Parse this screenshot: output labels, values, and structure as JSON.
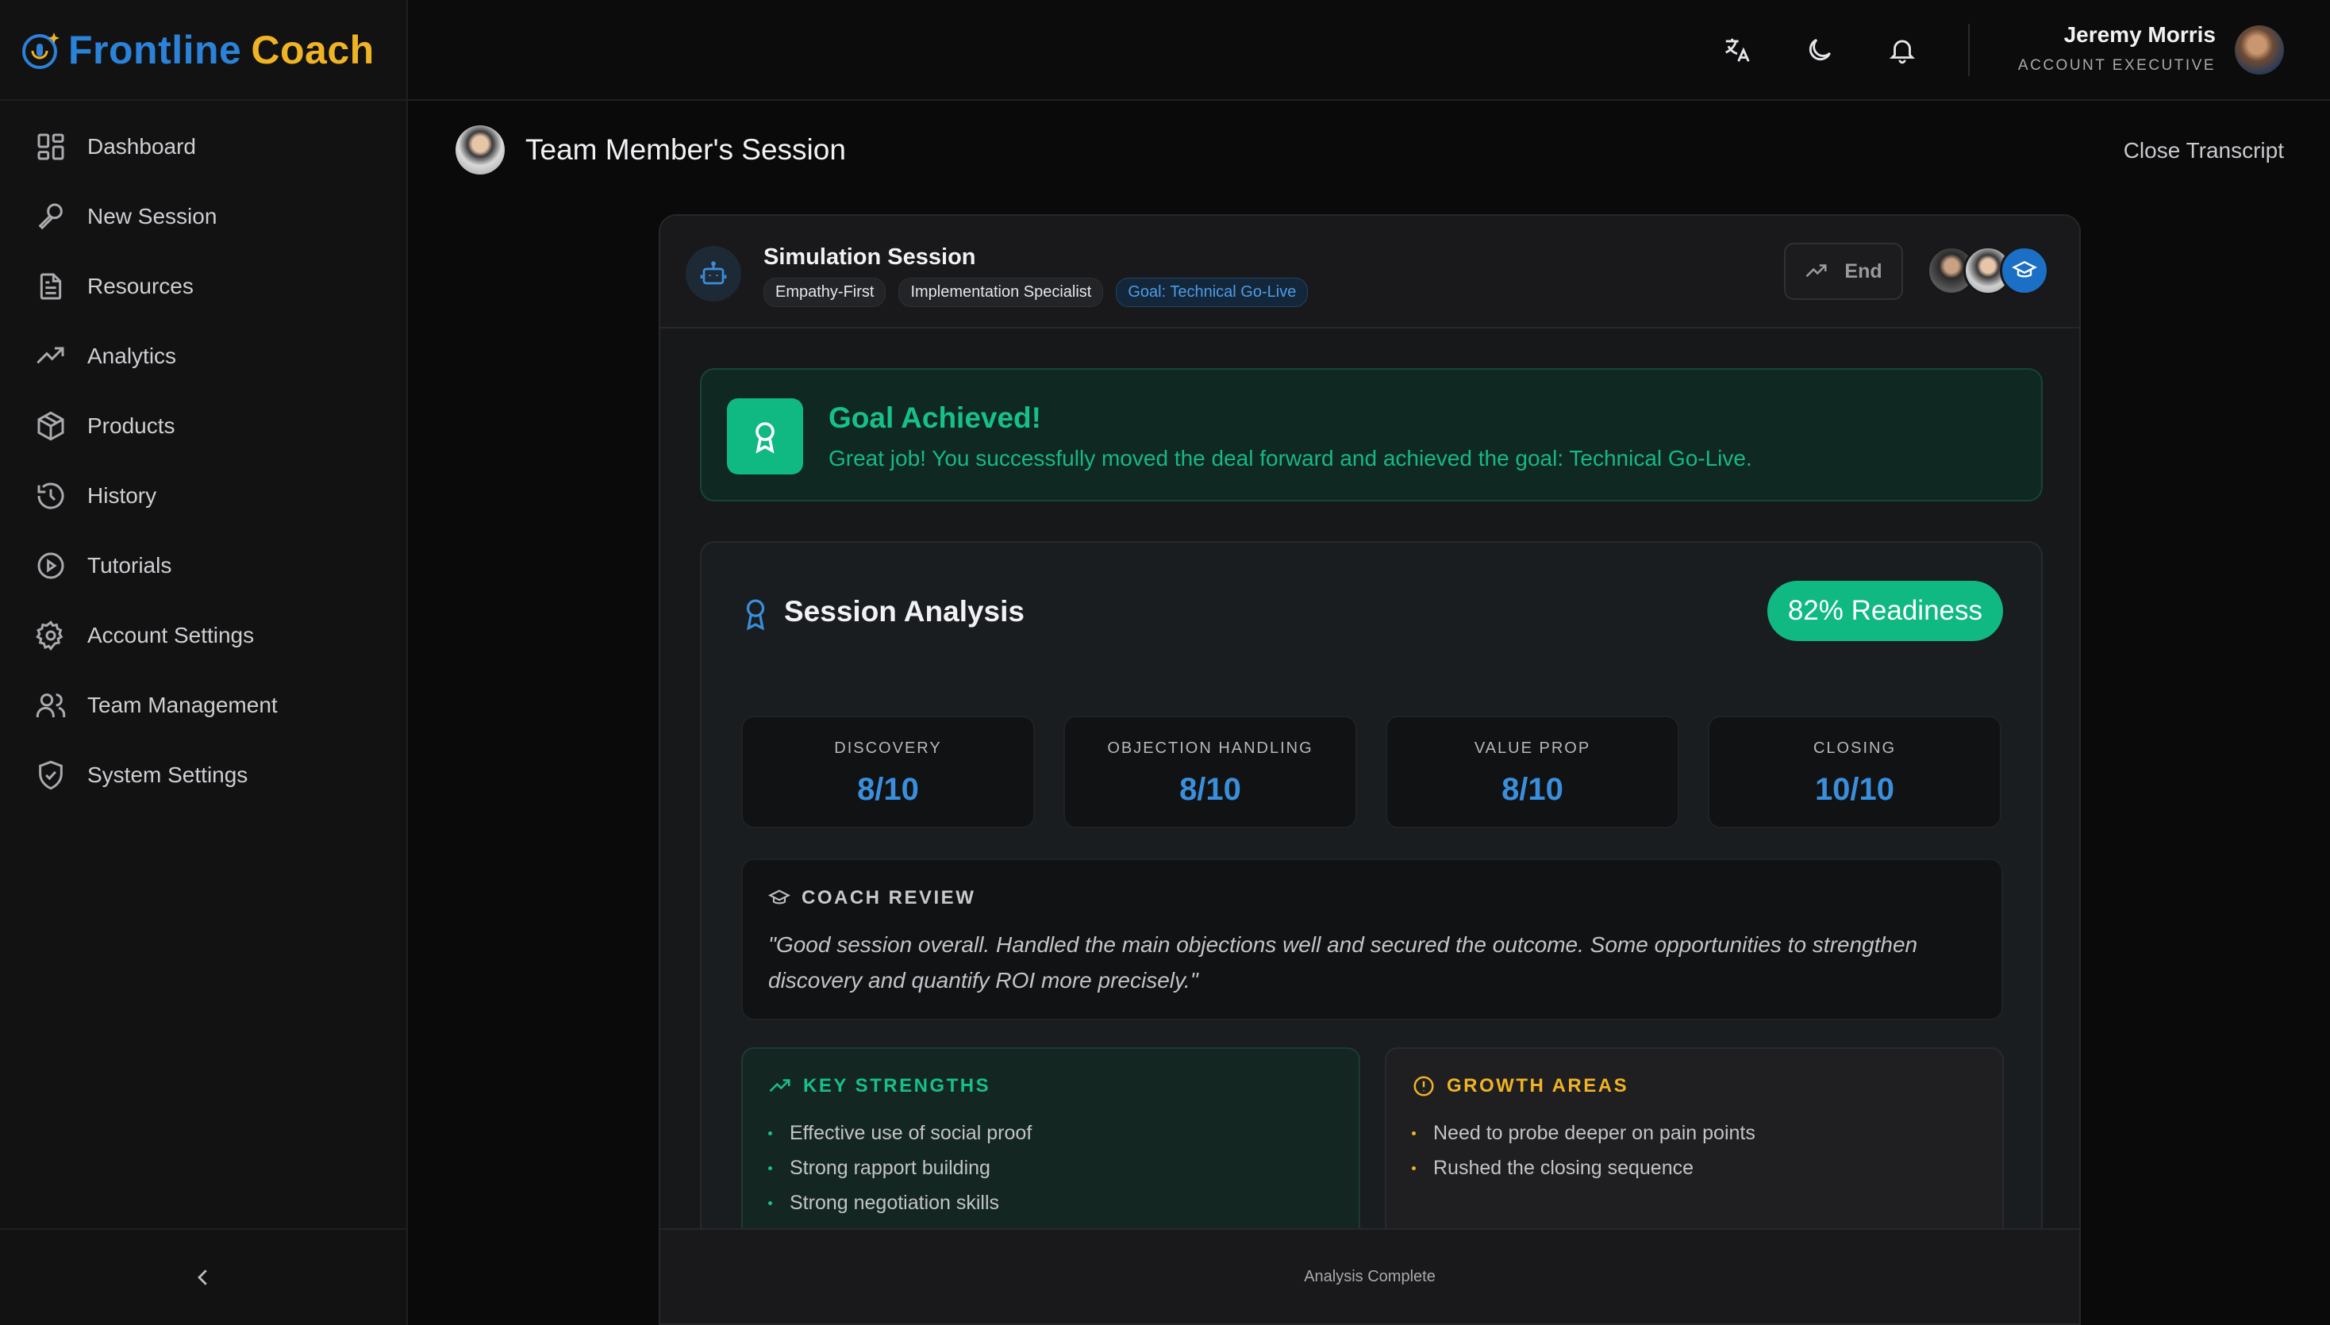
{
  "brand": {
    "part1": "Frontline",
    "part2": "Coach",
    "logo_icon": "mic-logo-icon"
  },
  "sidebar": {
    "items": [
      {
        "label": "Dashboard",
        "icon": "dashboard-grid-icon"
      },
      {
        "label": "New Session",
        "icon": "microphone-icon"
      },
      {
        "label": "Resources",
        "icon": "document-icon"
      },
      {
        "label": "Analytics",
        "icon": "trending-up-icon"
      },
      {
        "label": "Products",
        "icon": "box-icon"
      },
      {
        "label": "History",
        "icon": "history-icon"
      },
      {
        "label": "Tutorials",
        "icon": "play-circle-icon"
      },
      {
        "label": "Account Settings",
        "icon": "gear-icon"
      },
      {
        "label": "Team Management",
        "icon": "users-icon"
      },
      {
        "label": "System Settings",
        "icon": "shield-check-icon"
      }
    ],
    "collapse_icon": "chevron-left-icon"
  },
  "topbar": {
    "icons": [
      "translate-icon",
      "moon-icon",
      "bell-icon"
    ],
    "user": {
      "name": "Jeremy Morris",
      "role": "ACCOUNT EXECUTIVE"
    }
  },
  "page": {
    "title": "Team Member's Session",
    "close_label": "Close Transcript"
  },
  "session": {
    "title": "Simulation Session",
    "tags": [
      "Empathy-First",
      "Implementation Specialist",
      "Goal: Technical Go-Live"
    ],
    "end_label": "End"
  },
  "goal": {
    "title": "Goal Achieved!",
    "text": "Great job! You successfully moved the deal forward and achieved the goal: Technical Go-Live."
  },
  "analysis": {
    "title": "Session Analysis",
    "readiness": "82% Readiness",
    "scores": [
      {
        "label": "DISCOVERY",
        "value": "8/10"
      },
      {
        "label": "OBJECTION HANDLING",
        "value": "8/10"
      },
      {
        "label": "VALUE PROP",
        "value": "8/10"
      },
      {
        "label": "CLOSING",
        "value": "10/10"
      }
    ],
    "coach_review": {
      "heading": "COACH REVIEW",
      "text": "\"Good session overall. Handled the main objections well and secured the outcome. Some opportunities to strengthen discovery and quantify ROI more precisely.\""
    },
    "strengths": {
      "heading": "KEY STRENGTHS",
      "items": [
        "Effective use of social proof",
        "Strong rapport building",
        "Strong negotiation skills"
      ]
    },
    "growth": {
      "heading": "GROWTH AREAS",
      "items": [
        "Need to probe deeper on pain points",
        "Rushed the closing sequence"
      ]
    }
  },
  "footer": {
    "status": "Analysis Complete"
  },
  "colors": {
    "brand_blue": "#2b82d9",
    "brand_gold": "#f0b323",
    "success": "#10b981",
    "accent": "#3a8fdc"
  }
}
